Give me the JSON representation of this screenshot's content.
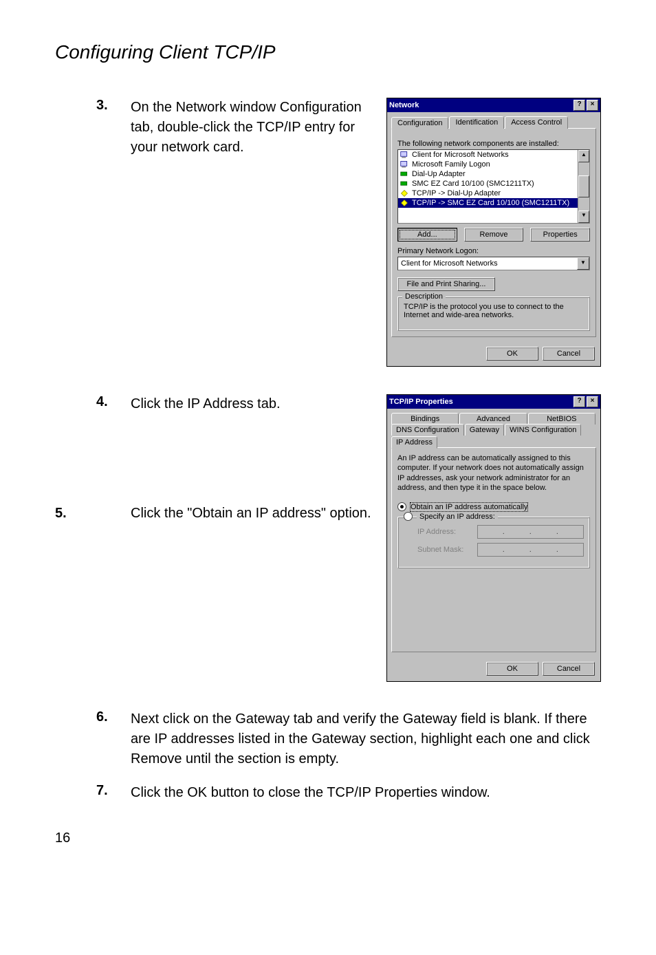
{
  "page": {
    "title": "Configuring Client TCP/IP",
    "number": "16"
  },
  "steps": {
    "s3": {
      "num": "3.",
      "text": "On the Network window Configuration tab, double-click the TCP/IP entry for your network card."
    },
    "s4": {
      "num": "4.",
      "text": "Click the IP Address tab."
    },
    "s5": {
      "num": "5.",
      "text": "Click the \"Obtain an IP address\" option."
    },
    "s6": {
      "num": "6.",
      "text": "Next click on the Gateway tab and verify the Gateway field is blank. If there are IP addresses listed in the Gateway section, highlight each one and click Remove until the section is empty."
    },
    "s7": {
      "num": "7.",
      "text": "Click the OK button to close the TCP/IP Properties window."
    }
  },
  "network_dlg": {
    "title": "Network",
    "tabs": {
      "configuration": "Configuration",
      "identification": "Identification",
      "access": "Access Control"
    },
    "list_label": "The following network components are installed:",
    "items": [
      "Client for Microsoft Networks",
      "Microsoft Family Logon",
      "Dial-Up Adapter",
      "SMC EZ Card 10/100 (SMC1211TX)",
      "TCP/IP -> Dial-Up Adapter",
      "TCP/IP -> SMC EZ Card 10/100 (SMC1211TX)"
    ],
    "buttons": {
      "add": "Add...",
      "remove": "Remove",
      "properties": "Properties"
    },
    "logon_label": "Primary Network Logon:",
    "logon_value": "Client for Microsoft Networks",
    "file_print": "File and Print Sharing...",
    "desc_title": "Description",
    "desc_text": "TCP/IP is the protocol you use to connect to the Internet and wide-area networks.",
    "ok": "OK",
    "cancel": "Cancel"
  },
  "tcpip_dlg": {
    "title": "TCP/IP Properties",
    "tabs_row1": {
      "bindings": "Bindings",
      "advanced": "Advanced",
      "netbios": "NetBIOS"
    },
    "tabs_row2": {
      "dns": "DNS Configuration",
      "gateway": "Gateway",
      "wins": "WINS Configuration",
      "ip": "IP Address"
    },
    "blurb": "An IP address can be automatically assigned to this computer. If your network does not automatically assign IP addresses, ask your network administrator for an address, and then type it in the space below.",
    "opt_auto": "Obtain an IP address automatically",
    "opt_specify": "Specify an IP address:",
    "ip_label": "IP Address:",
    "mask_label": "Subnet Mask:",
    "ok": "OK",
    "cancel": "Cancel"
  }
}
